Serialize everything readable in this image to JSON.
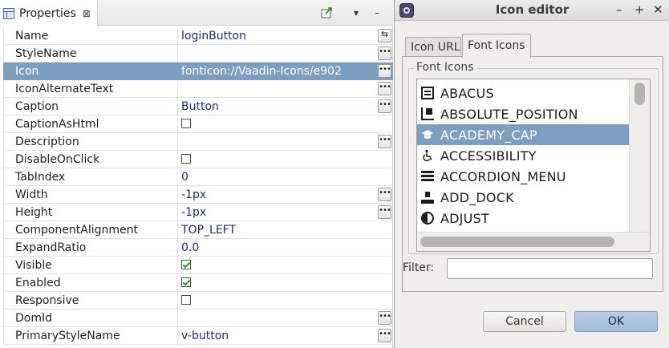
{
  "properties": {
    "tab_title": "Properties",
    "close_glyph": "⊠",
    "toolbar_icons": [
      "pin-icon",
      "view-menu-icon",
      "minimize-icon"
    ],
    "toolbar_glyphs": [
      "▾",
      "–"
    ],
    "rows": [
      {
        "name": "Name",
        "value": "loginButton",
        "type": "text",
        "button": "swap"
      },
      {
        "name": "StyleName",
        "value": "",
        "type": "text",
        "button": "dots"
      },
      {
        "name": "Icon",
        "value": "fonticon://Vaadin-Icons/e902",
        "type": "text",
        "button": "dots",
        "selected": true
      },
      {
        "name": "IconAlternateText",
        "value": "",
        "type": "text",
        "button": "dots"
      },
      {
        "name": "Caption",
        "value": "Button",
        "type": "text",
        "button": "dots"
      },
      {
        "name": "CaptionAsHtml",
        "value": "false",
        "type": "checkbox"
      },
      {
        "name": "Description",
        "value": "",
        "type": "text",
        "button": "dots"
      },
      {
        "name": "DisableOnClick",
        "value": "false",
        "type": "checkbox"
      },
      {
        "name": "TabIndex",
        "value": "0",
        "type": "text"
      },
      {
        "name": "Width",
        "value": "-1px",
        "type": "text",
        "button": "dots"
      },
      {
        "name": "Height",
        "value": "-1px",
        "type": "text",
        "button": "dots"
      },
      {
        "name": "ComponentAlignment",
        "value": "TOP_LEFT",
        "type": "text"
      },
      {
        "name": "ExpandRatio",
        "value": "0.0",
        "type": "text"
      },
      {
        "name": "Visible",
        "value": "true",
        "type": "checkbox"
      },
      {
        "name": "Enabled",
        "value": "true",
        "type": "checkbox"
      },
      {
        "name": "Responsive",
        "value": "false",
        "type": "checkbox"
      },
      {
        "name": "DomId",
        "value": "",
        "type": "text",
        "button": "dots"
      },
      {
        "name": "PrimaryStyleName",
        "value": "v-button",
        "type": "text",
        "button": "dots"
      }
    ],
    "dots_glyph": "•••",
    "swap_glyph": "⇆"
  },
  "dialog": {
    "title": "Icon editor",
    "window_buttons": {
      "minimize": "–",
      "maximize": "+",
      "close": "✕"
    },
    "tabs": [
      {
        "label": "Icon URL",
        "active": false
      },
      {
        "label": "Font Icons",
        "active": true
      }
    ],
    "group_label": "Font Icons",
    "icons": [
      {
        "label": "ABACUS",
        "icon": "abacus-icon",
        "selected": false
      },
      {
        "label": "ABSOLUTE_POSITION",
        "icon": "absolute-position-icon",
        "selected": false
      },
      {
        "label": "ACADEMY_CAP",
        "icon": "academy-cap-icon",
        "selected": true
      },
      {
        "label": "ACCESSIBILITY",
        "icon": "accessibility-icon",
        "selected": false
      },
      {
        "label": "ACCORDION_MENU",
        "icon": "accordion-menu-icon",
        "selected": false
      },
      {
        "label": "ADD_DOCK",
        "icon": "add-dock-icon",
        "selected": false
      },
      {
        "label": "ADJUST",
        "icon": "adjust-icon",
        "selected": false
      }
    ],
    "filter_label": "Filter:",
    "filter_value": "",
    "cancel_label": "Cancel",
    "ok_label": "OK",
    "colors": {
      "selection": "#7d9fbf",
      "value_text": "#1c2b74"
    }
  }
}
